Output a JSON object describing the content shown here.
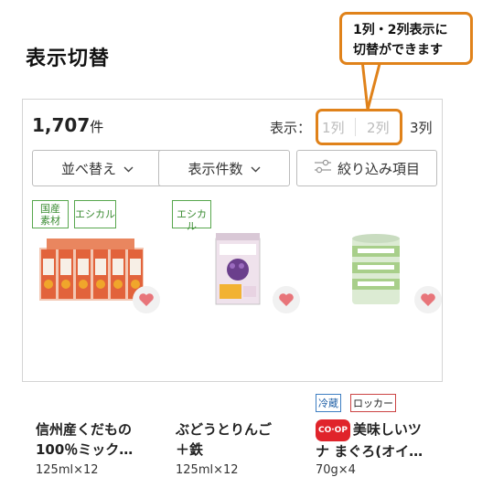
{
  "page": {
    "title": "表示切替"
  },
  "callout": {
    "line1": "1列・2列表示に",
    "line2": "切替ができます"
  },
  "toolbar": {
    "count": "1,707",
    "count_unit": "件",
    "display_label": "表示：",
    "options": [
      "1列",
      "2列",
      "3列"
    ],
    "selected": "3列"
  },
  "controls": {
    "sort": "並べ替え",
    "per_page": "表示件数",
    "filter": "絞り込み項目"
  },
  "products": [
    {
      "badges": [
        "国産\n素材",
        "エシカル"
      ],
      "name_l1": "信州産くだもの",
      "name_l2": "100％ミック…",
      "spec": "125ml×12"
    },
    {
      "badges": [
        "エシカル"
      ],
      "name_l1": "ぶどうとりんご",
      "name_l2": "＋鉄",
      "spec": "125ml×12"
    },
    {
      "tags": [
        "冷蔵",
        "ロッカー"
      ],
      "brand": "CO·OP",
      "name_l1": "美味しいツ",
      "name_l2": "ナ まぐろ(オイ…",
      "spec": "70g×4"
    }
  ],
  "colors": {
    "accent": "#e0821a",
    "badge": "#58a74e",
    "heart": "#e8757a"
  }
}
